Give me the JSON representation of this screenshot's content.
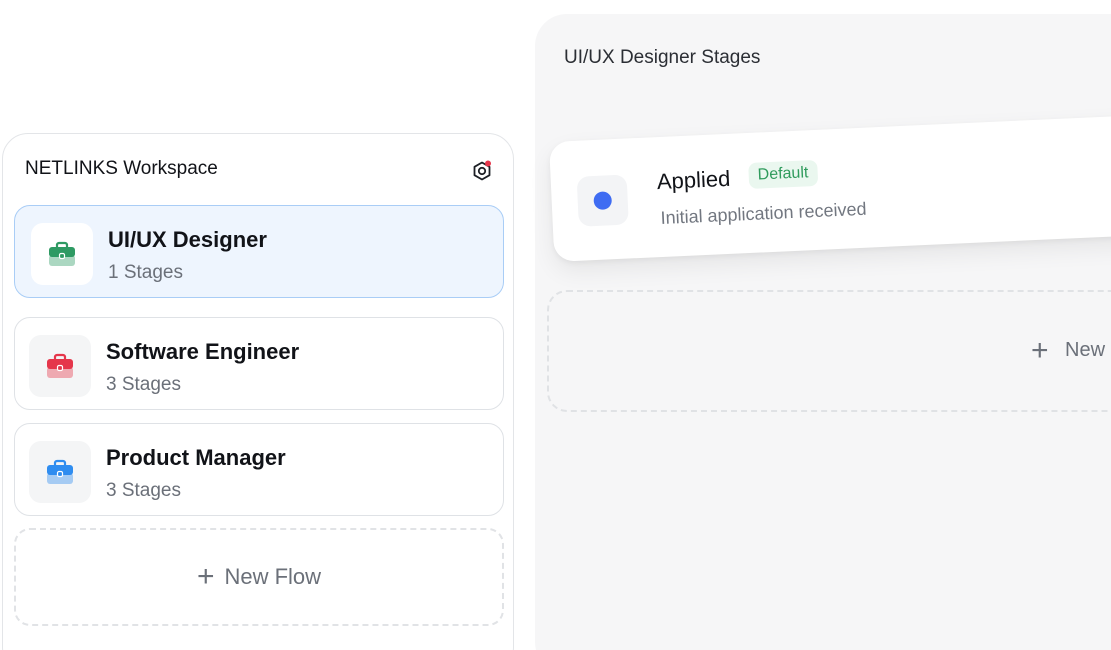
{
  "workspace": {
    "title": "NETLINKS Workspace",
    "settings_icon": "settings-hex-icon",
    "notification_color": "#e5364b",
    "flows": [
      {
        "name": "UI/UX Designer",
        "stages": "1 Stages",
        "icon": "briefcase-icon",
        "color": "#2e9a63",
        "selected": true
      },
      {
        "name": "Software Engineer",
        "stages": "3 Stages",
        "icon": "briefcase-icon",
        "color": "#e5364b",
        "selected": false
      },
      {
        "name": "Product Manager",
        "stages": "3 Stages",
        "icon": "briefcase-icon",
        "color": "#2f8df0",
        "selected": false
      }
    ],
    "new_flow_label": "New Flow"
  },
  "stages_panel": {
    "title": "UI/UX Designer Stages",
    "stages": [
      {
        "name": "Applied",
        "badge": "Default",
        "description": "Initial application received",
        "color": "#3f6cf2"
      }
    ],
    "new_stage_label": "New"
  }
}
